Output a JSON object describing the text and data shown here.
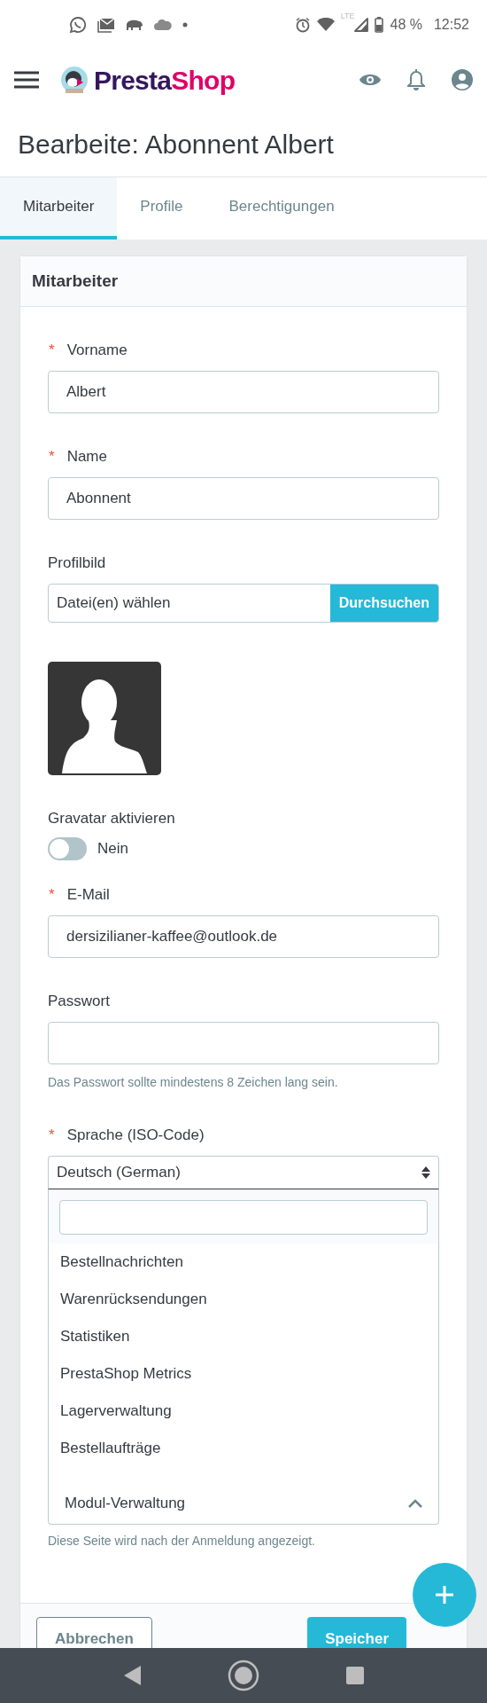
{
  "status_bar": {
    "network": "LTE",
    "battery": "48 %",
    "time": "12:52"
  },
  "header": {
    "logo_first": "Presta",
    "logo_second": "Shop"
  },
  "title": "Bearbeite: Abonnent Albert",
  "tabs": [
    {
      "label": "Mitarbeiter",
      "selected": true
    },
    {
      "label": "Profile",
      "selected": false
    },
    {
      "label": "Berechtigungen",
      "selected": false
    }
  ],
  "card": {
    "title": "Mitarbeiter",
    "required_mark": "*",
    "fields": [
      {
        "kind": "text",
        "label": "Vorname",
        "required": true,
        "value": "Albert"
      },
      {
        "kind": "text",
        "label": "Name",
        "required": true,
        "value": "Abonnent"
      },
      {
        "kind": "file",
        "label": "Profilbild",
        "required": false,
        "placeholder": "Datei(en) wählen",
        "button": "Durchsuchen"
      },
      {
        "kind": "picture"
      },
      {
        "kind": "toggle",
        "label": "Gravatar aktivieren",
        "required": false,
        "on": false,
        "state_label": "Nein"
      },
      {
        "kind": "text",
        "label": "E-Mail",
        "required": true,
        "value": "dersizilianer-kaffee@outlook.de"
      },
      {
        "kind": "password",
        "label": "Passwort",
        "required": false,
        "help": "Das Passwort sollte mindestens 8 Zeichen lang sein."
      },
      {
        "kind": "select",
        "label": "Sprache (ISO-Code)",
        "required": true,
        "value": "Deutsch (German)"
      },
      {
        "kind": "combobox",
        "open": true,
        "value": "Modul-Verwaltung",
        "options": [
          "Bestellnachrichten",
          "Warenrücksendungen",
          "Statistiken",
          "PrestaShop Metrics",
          "Lagerverwaltung",
          "Bestellaufträge"
        ],
        "help": "Diese Seite wird nach der Anmeldung angezeigt."
      }
    ]
  },
  "footer": {
    "cancel": "Abbrechen",
    "save": "Speicher"
  }
}
